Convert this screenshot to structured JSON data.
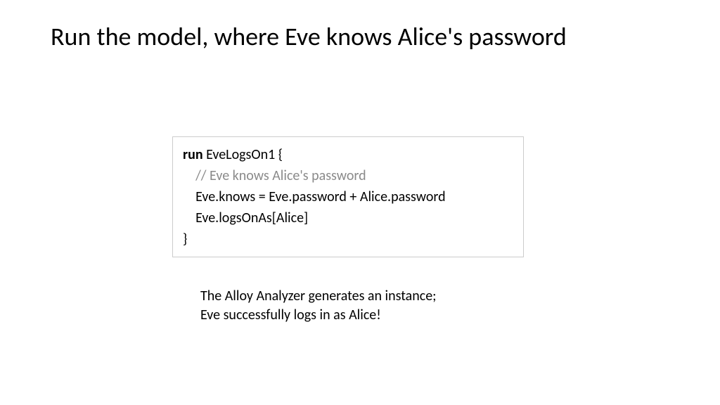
{
  "title": "Run the model, where Eve knows Alice's password",
  "code": {
    "keyword": "run",
    "line1_rest": " EveLogsOn1 {",
    "line2": "    // Eve knows Alice's password",
    "line3": "    Eve.knows = Eve.password + Alice.password",
    "line4": "    Eve.logsOnAs[Alice]",
    "line5": "}"
  },
  "caption": {
    "line1": "The Alloy Analyzer generates an instance;",
    "line2": "Eve successfully logs in as Alice!"
  }
}
